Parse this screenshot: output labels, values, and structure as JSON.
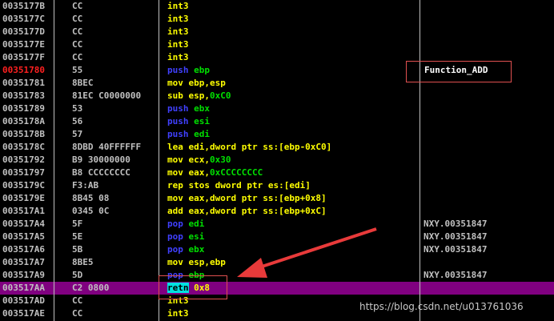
{
  "colors": {
    "background": "#000000",
    "address": "#c0c0c0",
    "address_current": "#ff2020",
    "selected_row": "#800080",
    "mnemonic_push_pop": "#4040ff",
    "mnemonic_other": "#ffff00",
    "register": "#00e000",
    "annotation_box": "#e05050",
    "arrow": "#e83a3a"
  },
  "rows": [
    {
      "address": "0035177B",
      "hex": "CC",
      "parts": [
        {
          "t": "int3",
          "c": "yellow"
        }
      ],
      "comment": ""
    },
    {
      "address": "0035177C",
      "hex": "CC",
      "parts": [
        {
          "t": "int3",
          "c": "yellow"
        }
      ],
      "comment": ""
    },
    {
      "address": "0035177D",
      "hex": "CC",
      "parts": [
        {
          "t": "int3",
          "c": "yellow"
        }
      ],
      "comment": ""
    },
    {
      "address": "0035177E",
      "hex": "CC",
      "parts": [
        {
          "t": "int3",
          "c": "yellow"
        }
      ],
      "comment": ""
    },
    {
      "address": "0035177F",
      "hex": "CC",
      "parts": [
        {
          "t": "int3",
          "c": "yellow"
        }
      ],
      "comment": ""
    },
    {
      "address": "00351780",
      "red": true,
      "hex": "55",
      "parts": [
        {
          "t": "push ",
          "c": "blue"
        },
        {
          "t": "ebp",
          "c": "green"
        }
      ],
      "comment": ""
    },
    {
      "address": "00351781",
      "hex": "8BEC",
      "parts": [
        {
          "t": "mov ebp,esp",
          "c": "yellow"
        }
      ],
      "comment": ""
    },
    {
      "address": "00351783",
      "hex": "81EC C0000000",
      "parts": [
        {
          "t": "sub esp,",
          "c": "yellow"
        },
        {
          "t": "0xC0",
          "c": "green"
        }
      ],
      "comment": ""
    },
    {
      "address": "00351789",
      "hex": "53",
      "parts": [
        {
          "t": "push ",
          "c": "blue"
        },
        {
          "t": "ebx",
          "c": "green"
        }
      ],
      "comment": ""
    },
    {
      "address": "0035178A",
      "hex": "56",
      "parts": [
        {
          "t": "push ",
          "c": "blue"
        },
        {
          "t": "esi",
          "c": "green"
        }
      ],
      "comment": ""
    },
    {
      "address": "0035178B",
      "hex": "57",
      "parts": [
        {
          "t": "push ",
          "c": "blue"
        },
        {
          "t": "edi",
          "c": "green"
        }
      ],
      "comment": ""
    },
    {
      "address": "0035178C",
      "hex": "8DBD 40FFFFFF",
      "parts": [
        {
          "t": "lea edi,dword ptr ss:[ebp-0xC0]",
          "c": "yellow"
        }
      ],
      "comment": ""
    },
    {
      "address": "00351792",
      "hex": "B9 30000000",
      "parts": [
        {
          "t": "mov ecx,",
          "c": "yellow"
        },
        {
          "t": "0x30",
          "c": "green"
        }
      ],
      "comment": ""
    },
    {
      "address": "00351797",
      "hex": "B8 CCCCCCCC",
      "parts": [
        {
          "t": "mov eax,",
          "c": "yellow"
        },
        {
          "t": "0xCCCCCCCC",
          "c": "green"
        }
      ],
      "comment": ""
    },
    {
      "address": "0035179C",
      "hex": "F3:AB",
      "parts": [
        {
          "t": "rep stos ",
          "c": "yellow"
        },
        {
          "t": "dword ptr es:[edi]",
          "c": "yellow"
        }
      ],
      "comment": ""
    },
    {
      "address": "0035179E",
      "hex": "8B45 08",
      "parts": [
        {
          "t": "mov eax,dword ptr ss:[ebp+0x8]",
          "c": "yellow"
        }
      ],
      "comment": ""
    },
    {
      "address": "003517A1",
      "hex": "0345 0C",
      "parts": [
        {
          "t": "add eax,dword ptr ss:[ebp+0xC]",
          "c": "yellow"
        }
      ],
      "comment": ""
    },
    {
      "address": "003517A4",
      "hex": "5F",
      "parts": [
        {
          "t": "pop ",
          "c": "blue"
        },
        {
          "t": "edi",
          "c": "green"
        }
      ],
      "comment": "NXY.00351847"
    },
    {
      "address": "003517A5",
      "hex": "5E",
      "parts": [
        {
          "t": "pop ",
          "c": "blue"
        },
        {
          "t": "esi",
          "c": "green"
        }
      ],
      "comment": "NXY.00351847"
    },
    {
      "address": "003517A6",
      "hex": "5B",
      "parts": [
        {
          "t": "pop ",
          "c": "blue"
        },
        {
          "t": "ebx",
          "c": "green"
        }
      ],
      "comment": "NXY.00351847"
    },
    {
      "address": "003517A7",
      "hex": "8BE5",
      "parts": [
        {
          "t": "mov esp,ebp",
          "c": "yellow"
        }
      ],
      "comment": ""
    },
    {
      "address": "003517A9",
      "hex": "5D",
      "parts": [
        {
          "t": "pop ",
          "c": "blue"
        },
        {
          "t": "ebp",
          "c": "green"
        }
      ],
      "comment": "NXY.00351847"
    },
    {
      "address": "003517AA",
      "hex": "C2 0800",
      "selected": true,
      "parts": [
        {
          "t": "retn",
          "c": "hl"
        },
        {
          "t": " ",
          "c": "white"
        },
        {
          "t": "0x8",
          "c": "yellow"
        }
      ],
      "comment": ""
    },
    {
      "address": "003517AD",
      "hex": "CC",
      "parts": [
        {
          "t": "int3",
          "c": "yellow"
        }
      ],
      "comment": ""
    },
    {
      "address": "003517AE",
      "hex": "CC",
      "parts": [
        {
          "t": "int3",
          "c": "yellow"
        }
      ],
      "comment": ""
    }
  ],
  "annotation": {
    "label": "Function_ADD"
  },
  "watermark": "https://blog.csdn.net/u013761036"
}
